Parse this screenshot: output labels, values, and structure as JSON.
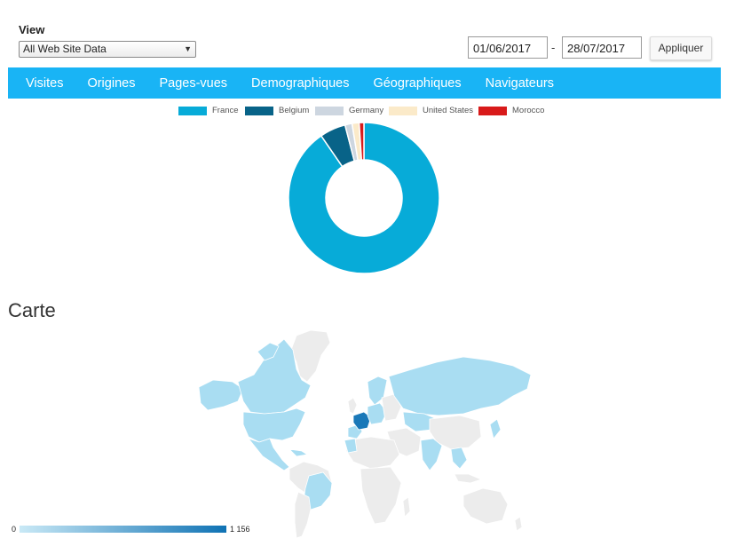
{
  "filter": {
    "view_label": "View",
    "view_selected": "All Web Site Data",
    "date_from": "01/06/2017",
    "date_separator": "-",
    "date_to": "28/07/2017",
    "apply_label": "Appliquer"
  },
  "nav": {
    "items": [
      {
        "label": "Visites"
      },
      {
        "label": "Origines"
      },
      {
        "label": "Pages-vues"
      },
      {
        "label": "Demographiques"
      },
      {
        "label": "Géographiques"
      },
      {
        "label": "Navigateurs"
      }
    ]
  },
  "chart_data": {
    "type": "pie",
    "donut": true,
    "categories": [
      "France",
      "Belgium",
      "Germany",
      "United States",
      "Morocco"
    ],
    "values": [
      89.5,
      5.5,
      1.5,
      1.5,
      1.0
    ],
    "colors": [
      "#07abd8",
      "#086388",
      "#cdd6e0",
      "#fbeac9",
      "#d81a1a"
    ],
    "legend_position": "top"
  },
  "map": {
    "title": "Carte",
    "scale_min": "0",
    "scale_max": "1 156",
    "colors": {
      "none": "#ececec",
      "low": "#a9ddf2",
      "high": "#1a78b8",
      "border": "#ffffff"
    }
  }
}
